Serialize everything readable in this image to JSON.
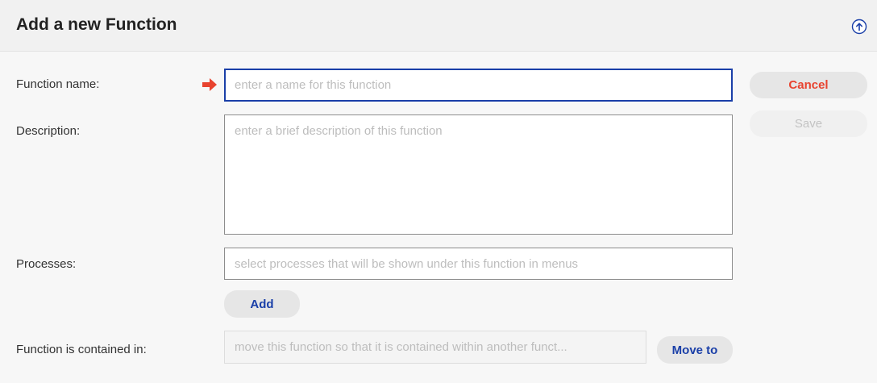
{
  "header": {
    "title": "Add a new Function",
    "collapse_icon": "arrow-up-circle-icon"
  },
  "form": {
    "name": {
      "label": "Function name:",
      "placeholder": "enter a name for this function",
      "value": ""
    },
    "description": {
      "label": "Description:",
      "placeholder": "enter a brief description of this function",
      "value": ""
    },
    "processes": {
      "label": "Processes:",
      "placeholder": "select processes that will be shown under this function in menus",
      "value": ""
    },
    "contained_in": {
      "label": "Function is contained in:",
      "placeholder": "move this function so that it is contained within another funct...",
      "value": ""
    }
  },
  "actions": {
    "cancel": "Cancel",
    "save": "Save",
    "add": "Add",
    "move_to": "Move to"
  },
  "colors": {
    "accent_blue": "#1a3fa8",
    "cancel_red": "#e8432f",
    "required_arrow": "#e8432f"
  }
}
